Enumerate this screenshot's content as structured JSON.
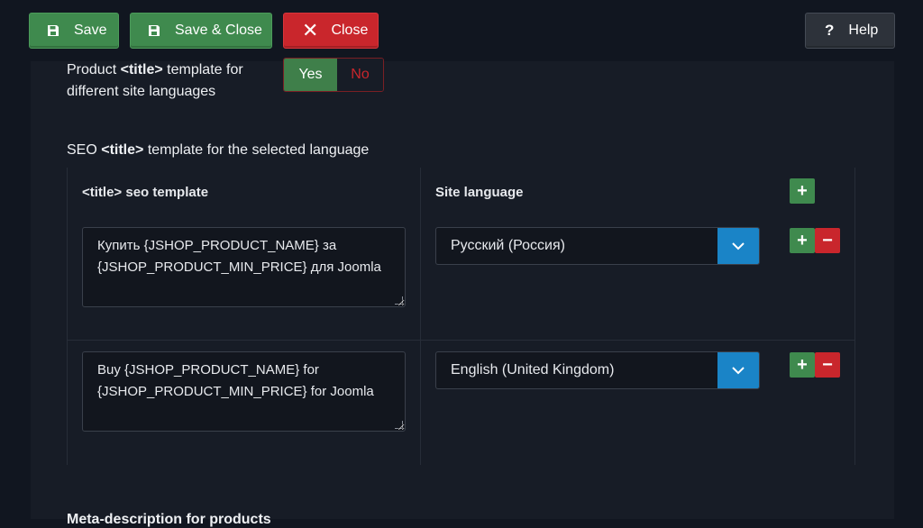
{
  "toolbar": {
    "save_label": "Save",
    "save_close_label": "Save & Close",
    "close_label": "Close",
    "help_label": "Help",
    "help_icon": "?",
    "close_icon": "✕"
  },
  "product_title": {
    "label_pre": "Product ",
    "label_tag": "<title>",
    "label_post": " template for different site languages",
    "yes": "Yes",
    "no": "No"
  },
  "seo": {
    "label_pre": "SEO ",
    "label_tag": "<title>",
    "label_post": " template for the selected language",
    "col_template_tag": "<title>",
    "col_template_rest": " seo template",
    "col_language": "Site language",
    "rows": [
      {
        "template_line1": "Купить {JSHOP_PRODUCT_NAME} за",
        "template_line2": "{JSHOP_PRODUCT_MIN_PRICE} для Joomla",
        "language": "Русский (Россия)"
      },
      {
        "template_line1": "Buy {JSHOP_PRODUCT_NAME} for",
        "template_line2": "{JSHOP_PRODUCT_MIN_PRICE} for Joomla",
        "language": "English (United Kingdom)"
      }
    ]
  },
  "meta_description": {
    "label": "Meta-description for products"
  },
  "colors": {
    "background": "#111620",
    "panel": "#171c26",
    "success": "#3f8a4e",
    "danger": "#c9262c",
    "primary": "#1a84c7"
  }
}
